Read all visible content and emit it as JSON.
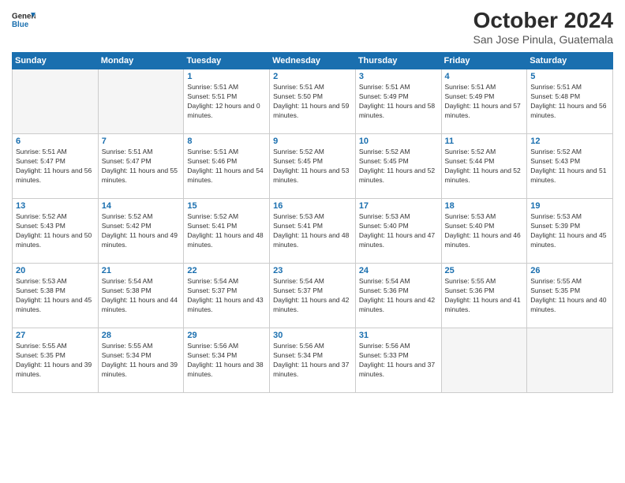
{
  "header": {
    "logo_general": "General",
    "logo_blue": "Blue",
    "month_title": "October 2024",
    "location": "San Jose Pinula, Guatemala"
  },
  "weekdays": [
    "Sunday",
    "Monday",
    "Tuesday",
    "Wednesday",
    "Thursday",
    "Friday",
    "Saturday"
  ],
  "weeks": [
    [
      {
        "day": "",
        "empty": true
      },
      {
        "day": "",
        "empty": true
      },
      {
        "day": "1",
        "sunrise": "Sunrise: 5:51 AM",
        "sunset": "Sunset: 5:51 PM",
        "daylight": "Daylight: 12 hours and 0 minutes."
      },
      {
        "day": "2",
        "sunrise": "Sunrise: 5:51 AM",
        "sunset": "Sunset: 5:50 PM",
        "daylight": "Daylight: 11 hours and 59 minutes."
      },
      {
        "day": "3",
        "sunrise": "Sunrise: 5:51 AM",
        "sunset": "Sunset: 5:49 PM",
        "daylight": "Daylight: 11 hours and 58 minutes."
      },
      {
        "day": "4",
        "sunrise": "Sunrise: 5:51 AM",
        "sunset": "Sunset: 5:49 PM",
        "daylight": "Daylight: 11 hours and 57 minutes."
      },
      {
        "day": "5",
        "sunrise": "Sunrise: 5:51 AM",
        "sunset": "Sunset: 5:48 PM",
        "daylight": "Daylight: 11 hours and 56 minutes."
      }
    ],
    [
      {
        "day": "6",
        "sunrise": "Sunrise: 5:51 AM",
        "sunset": "Sunset: 5:47 PM",
        "daylight": "Daylight: 11 hours and 56 minutes."
      },
      {
        "day": "7",
        "sunrise": "Sunrise: 5:51 AM",
        "sunset": "Sunset: 5:47 PM",
        "daylight": "Daylight: 11 hours and 55 minutes."
      },
      {
        "day": "8",
        "sunrise": "Sunrise: 5:51 AM",
        "sunset": "Sunset: 5:46 PM",
        "daylight": "Daylight: 11 hours and 54 minutes."
      },
      {
        "day": "9",
        "sunrise": "Sunrise: 5:52 AM",
        "sunset": "Sunset: 5:45 PM",
        "daylight": "Daylight: 11 hours and 53 minutes."
      },
      {
        "day": "10",
        "sunrise": "Sunrise: 5:52 AM",
        "sunset": "Sunset: 5:45 PM",
        "daylight": "Daylight: 11 hours and 52 minutes."
      },
      {
        "day": "11",
        "sunrise": "Sunrise: 5:52 AM",
        "sunset": "Sunset: 5:44 PM",
        "daylight": "Daylight: 11 hours and 52 minutes."
      },
      {
        "day": "12",
        "sunrise": "Sunrise: 5:52 AM",
        "sunset": "Sunset: 5:43 PM",
        "daylight": "Daylight: 11 hours and 51 minutes."
      }
    ],
    [
      {
        "day": "13",
        "sunrise": "Sunrise: 5:52 AM",
        "sunset": "Sunset: 5:43 PM",
        "daylight": "Daylight: 11 hours and 50 minutes."
      },
      {
        "day": "14",
        "sunrise": "Sunrise: 5:52 AM",
        "sunset": "Sunset: 5:42 PM",
        "daylight": "Daylight: 11 hours and 49 minutes."
      },
      {
        "day": "15",
        "sunrise": "Sunrise: 5:52 AM",
        "sunset": "Sunset: 5:41 PM",
        "daylight": "Daylight: 11 hours and 48 minutes."
      },
      {
        "day": "16",
        "sunrise": "Sunrise: 5:53 AM",
        "sunset": "Sunset: 5:41 PM",
        "daylight": "Daylight: 11 hours and 48 minutes."
      },
      {
        "day": "17",
        "sunrise": "Sunrise: 5:53 AM",
        "sunset": "Sunset: 5:40 PM",
        "daylight": "Daylight: 11 hours and 47 minutes."
      },
      {
        "day": "18",
        "sunrise": "Sunrise: 5:53 AM",
        "sunset": "Sunset: 5:40 PM",
        "daylight": "Daylight: 11 hours and 46 minutes."
      },
      {
        "day": "19",
        "sunrise": "Sunrise: 5:53 AM",
        "sunset": "Sunset: 5:39 PM",
        "daylight": "Daylight: 11 hours and 45 minutes."
      }
    ],
    [
      {
        "day": "20",
        "sunrise": "Sunrise: 5:53 AM",
        "sunset": "Sunset: 5:38 PM",
        "daylight": "Daylight: 11 hours and 45 minutes."
      },
      {
        "day": "21",
        "sunrise": "Sunrise: 5:54 AM",
        "sunset": "Sunset: 5:38 PM",
        "daylight": "Daylight: 11 hours and 44 minutes."
      },
      {
        "day": "22",
        "sunrise": "Sunrise: 5:54 AM",
        "sunset": "Sunset: 5:37 PM",
        "daylight": "Daylight: 11 hours and 43 minutes."
      },
      {
        "day": "23",
        "sunrise": "Sunrise: 5:54 AM",
        "sunset": "Sunset: 5:37 PM",
        "daylight": "Daylight: 11 hours and 42 minutes."
      },
      {
        "day": "24",
        "sunrise": "Sunrise: 5:54 AM",
        "sunset": "Sunset: 5:36 PM",
        "daylight": "Daylight: 11 hours and 42 minutes."
      },
      {
        "day": "25",
        "sunrise": "Sunrise: 5:55 AM",
        "sunset": "Sunset: 5:36 PM",
        "daylight": "Daylight: 11 hours and 41 minutes."
      },
      {
        "day": "26",
        "sunrise": "Sunrise: 5:55 AM",
        "sunset": "Sunset: 5:35 PM",
        "daylight": "Daylight: 11 hours and 40 minutes."
      }
    ],
    [
      {
        "day": "27",
        "sunrise": "Sunrise: 5:55 AM",
        "sunset": "Sunset: 5:35 PM",
        "daylight": "Daylight: 11 hours and 39 minutes."
      },
      {
        "day": "28",
        "sunrise": "Sunrise: 5:55 AM",
        "sunset": "Sunset: 5:34 PM",
        "daylight": "Daylight: 11 hours and 39 minutes."
      },
      {
        "day": "29",
        "sunrise": "Sunrise: 5:56 AM",
        "sunset": "Sunset: 5:34 PM",
        "daylight": "Daylight: 11 hours and 38 minutes."
      },
      {
        "day": "30",
        "sunrise": "Sunrise: 5:56 AM",
        "sunset": "Sunset: 5:34 PM",
        "daylight": "Daylight: 11 hours and 37 minutes."
      },
      {
        "day": "31",
        "sunrise": "Sunrise: 5:56 AM",
        "sunset": "Sunset: 5:33 PM",
        "daylight": "Daylight: 11 hours and 37 minutes."
      },
      {
        "day": "",
        "empty": true
      },
      {
        "day": "",
        "empty": true
      }
    ]
  ]
}
